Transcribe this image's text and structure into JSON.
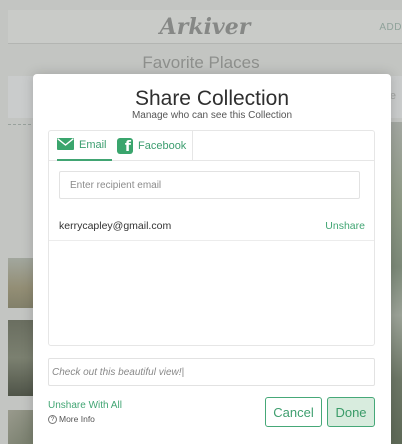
{
  "background": {
    "logo": "Arkiver",
    "add_label": "ADD",
    "subtitle": "Favorite Places",
    "side_letter": "e"
  },
  "modal": {
    "title": "Share Collection",
    "subtitle": "Manage who can see this Collection",
    "tabs": [
      {
        "label": "Email",
        "icon": "envelope-icon",
        "active": true
      },
      {
        "label": "Facebook",
        "icon": "facebook-icon",
        "active": false
      }
    ],
    "email_input": {
      "placeholder": "Enter recipient email",
      "value": ""
    },
    "recipients": [
      {
        "email": "kerrycapley@gmail.com",
        "action": "Unshare"
      }
    ],
    "message": {
      "value": "Check out this beautiful view!|"
    },
    "unshare_all": "Unshare With All",
    "more_info": "More Info",
    "help_glyph": "?",
    "buttons": {
      "cancel": "Cancel",
      "done": "Done"
    }
  },
  "colors": {
    "accent": "#41a573",
    "done_bg": "#d8ecde"
  }
}
